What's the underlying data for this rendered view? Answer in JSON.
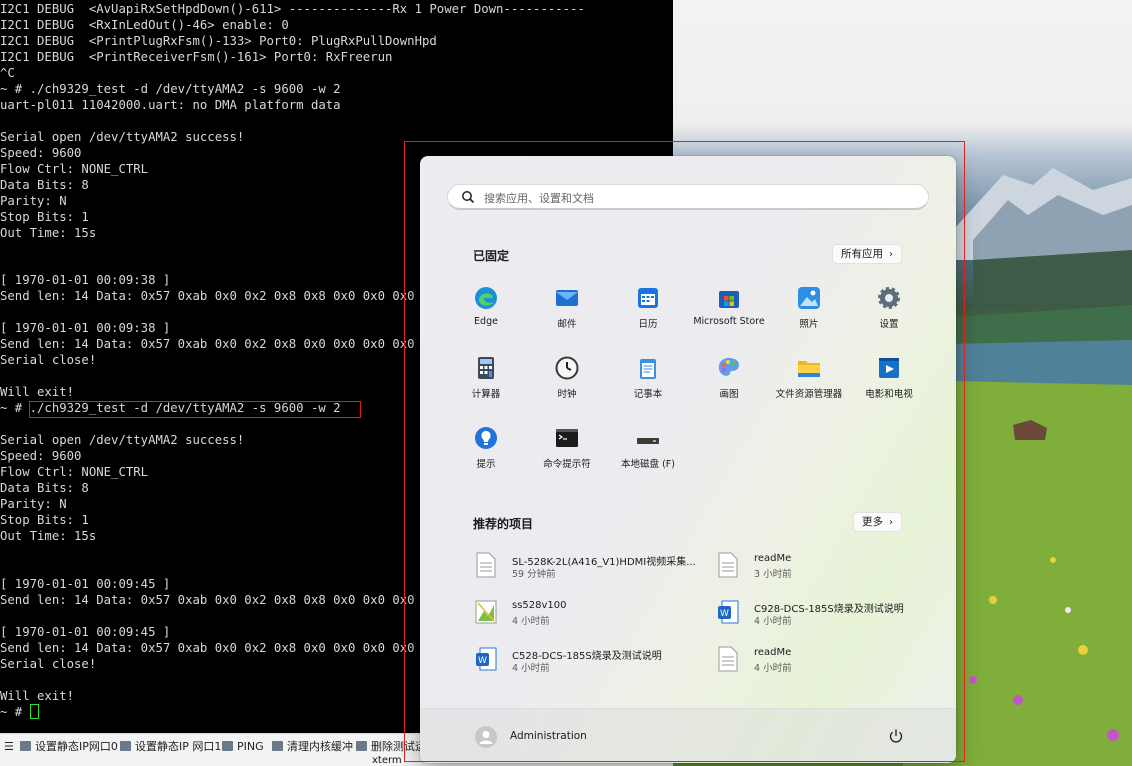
{
  "terminal": {
    "lines": [
      "I2C1 DEBUG  <AvUapiRxSetHpdDown()-611> --------------Rx 1 Power Down-----------",
      "I2C1 DEBUG  <RxInLedOut()-46> enable: 0",
      "I2C1 DEBUG  <PrintPlugRxFsm()-133> Port0: PlugRxPullDownHpd",
      "I2C1 DEBUG  <PrintReceiverFsm()-161> Port0: RxFreerun",
      "^C",
      "~ # ./ch9329_test -d /dev/ttyAMA2 -s 9600 -w 2",
      "uart-pl011 11042000.uart: no DMA platform data",
      "",
      "Serial open /dev/ttyAMA2 success!",
      "Speed: 9600",
      "Flow Ctrl: NONE_CTRL",
      "Data Bits: 8",
      "Parity: N",
      "Stop Bits: 1",
      "Out Time: 15s",
      "",
      "",
      "[ 1970-01-01 00:09:38 ]",
      "Send len: 14 Data: 0x57 0xab 0x0 0x2 0x8 0x8 0x0 0x0 0x0",
      "",
      "[ 1970-01-01 00:09:38 ]",
      "Send len: 14 Data: 0x57 0xab 0x0 0x2 0x8 0x0 0x0 0x0 0x0",
      "Serial close!",
      "",
      "Will exit!",
      "~ # ./ch9329_test -d /dev/ttyAMA2 -s 9600 -w 2",
      "",
      "Serial open /dev/ttyAMA2 success!",
      "Speed: 9600",
      "Flow Ctrl: NONE_CTRL",
      "Data Bits: 8",
      "Parity: N",
      "Stop Bits: 1",
      "Out Time: 15s",
      "",
      "",
      "[ 1970-01-01 00:09:45 ]",
      "Send len: 14 Data: 0x57 0xab 0x0 0x2 0x8 0x8 0x0 0x0 0x0",
      "",
      "[ 1970-01-01 00:09:45 ]",
      "Send len: 14 Data: 0x57 0xab 0x0 0x2 0x8 0x0 0x0 0x0 0x0",
      "Serial close!",
      "",
      "Will exit!",
      "~ # "
    ]
  },
  "taskbar": {
    "items": [
      "设置静态IP网口0",
      "设置静态IP 网口1",
      "PING",
      "清理内核缓冲",
      "删除测试运"
    ],
    "window_label": "xterm"
  },
  "start_menu": {
    "search_placeholder": "搜索应用、设置和文档",
    "pinned_title": "已固定",
    "all_apps_label": "所有应用",
    "pinned": [
      {
        "label": "Edge",
        "icon": "edge-icon"
      },
      {
        "label": "邮件",
        "icon": "mail-icon"
      },
      {
        "label": "日历",
        "icon": "calendar-icon"
      },
      {
        "label": "Microsoft Store",
        "icon": "store-icon"
      },
      {
        "label": "照片",
        "icon": "photos-icon"
      },
      {
        "label": "设置",
        "icon": "settings-icon"
      },
      {
        "label": "计算器",
        "icon": "calculator-icon"
      },
      {
        "label": "时钟",
        "icon": "clock-icon"
      },
      {
        "label": "记事本",
        "icon": "notepad-icon"
      },
      {
        "label": "画图",
        "icon": "paint-icon"
      },
      {
        "label": "文件资源管理器",
        "icon": "folder-icon"
      },
      {
        "label": "电影和电视",
        "icon": "movies-icon"
      },
      {
        "label": "提示",
        "icon": "tips-icon"
      },
      {
        "label": "命令提示符",
        "icon": "cmd-icon"
      },
      {
        "label": "本地磁盘 (F)",
        "icon": "drive-icon"
      }
    ],
    "recommended_title": "推荐的项目",
    "more_label": "更多",
    "recommended": [
      {
        "name": "SL-528K-2L(A416_V1)HDMI视频采集...",
        "time": "59 分钟前",
        "icon": "document-icon"
      },
      {
        "name": "readMe",
        "time": "3 小时前",
        "icon": "document-icon"
      },
      {
        "name": "ss528v100",
        "time": "4 小时前",
        "icon": "image-file-icon"
      },
      {
        "name": "C928-DCS-185S烧录及测试说明",
        "time": "4 小时前",
        "icon": "word-icon"
      },
      {
        "name": "C528-DCS-185S烧录及测试说明",
        "time": "4 小时前",
        "icon": "word-icon"
      },
      {
        "name": "readMe",
        "time": "4 小时前",
        "icon": "document-icon"
      }
    ],
    "user_name": "Administration"
  }
}
